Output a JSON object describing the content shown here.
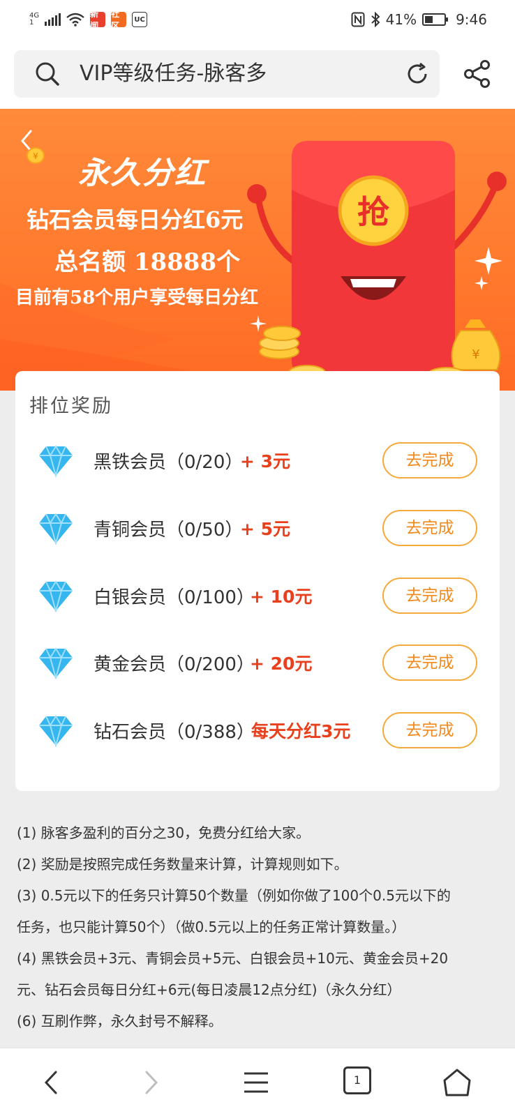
{
  "status_bar": {
    "network": "4G",
    "network_sub": "1",
    "battery": "41%",
    "battery_level": 0.41,
    "time": "9:46",
    "app_icons": [
      "新闻",
      "社区",
      "UC"
    ]
  },
  "address_bar": {
    "title": "VIP等级任务-脉客多"
  },
  "banner": {
    "heading": "永久分红",
    "line1": "钻石会员每日分红6元",
    "line2": "总名额 18888个",
    "line3": "目前有58个用户享受每日分红",
    "envelope_char": "抢",
    "coin_symbol": "¥"
  },
  "rewards": {
    "title": "排位奖励",
    "button_label": "去完成",
    "tiers": [
      {
        "name": "黑铁会员（0/20）",
        "reward": "+ 3元"
      },
      {
        "name": "青铜会员（0/50）",
        "reward": "+ 5元"
      },
      {
        "name": "白银会员（0/100）",
        "reward": "+ 10元"
      },
      {
        "name": "黄金会员（0/200）",
        "reward": "+ 20元"
      },
      {
        "name": "钻石会员（0/388）",
        "reward": "每天分红3元"
      }
    ]
  },
  "rules": [
    "(1) 脉客多盈利的百分之30，免费分红给大家。",
    "(2) 奖励是按照完成任务数量来计算，计算规则如下。",
    "(3) 0.5元以下的任务只计算50个数量（例如你做了100个0.5元以下的",
    "任务，也只能计算50个）（做0.5元以上的任务正常计算数量。）",
    "(4) 黑铁会员+3元、青铜会员+5元、白银会员+10元、黄金会员+20",
    "元、钻石会员每日分红+6元(每日凌晨12点分红)（永久分红）",
    "(6) 互刷作弊，永久封号不解释。"
  ],
  "bottom_nav": {
    "tab_count": "1"
  },
  "colors": {
    "accent_orange": "#ff7a2e",
    "reward_red": "#e8401c",
    "button_border": "#f4a93a",
    "diamond_blue": "#36b6ef"
  },
  "icons": [
    "search-icon",
    "refresh-icon",
    "share-icon",
    "back-arrow-icon",
    "forward-arrow-icon",
    "menu-icon",
    "tabs-icon",
    "home-icon",
    "diamond-icon",
    "red-envelope-icon"
  ]
}
